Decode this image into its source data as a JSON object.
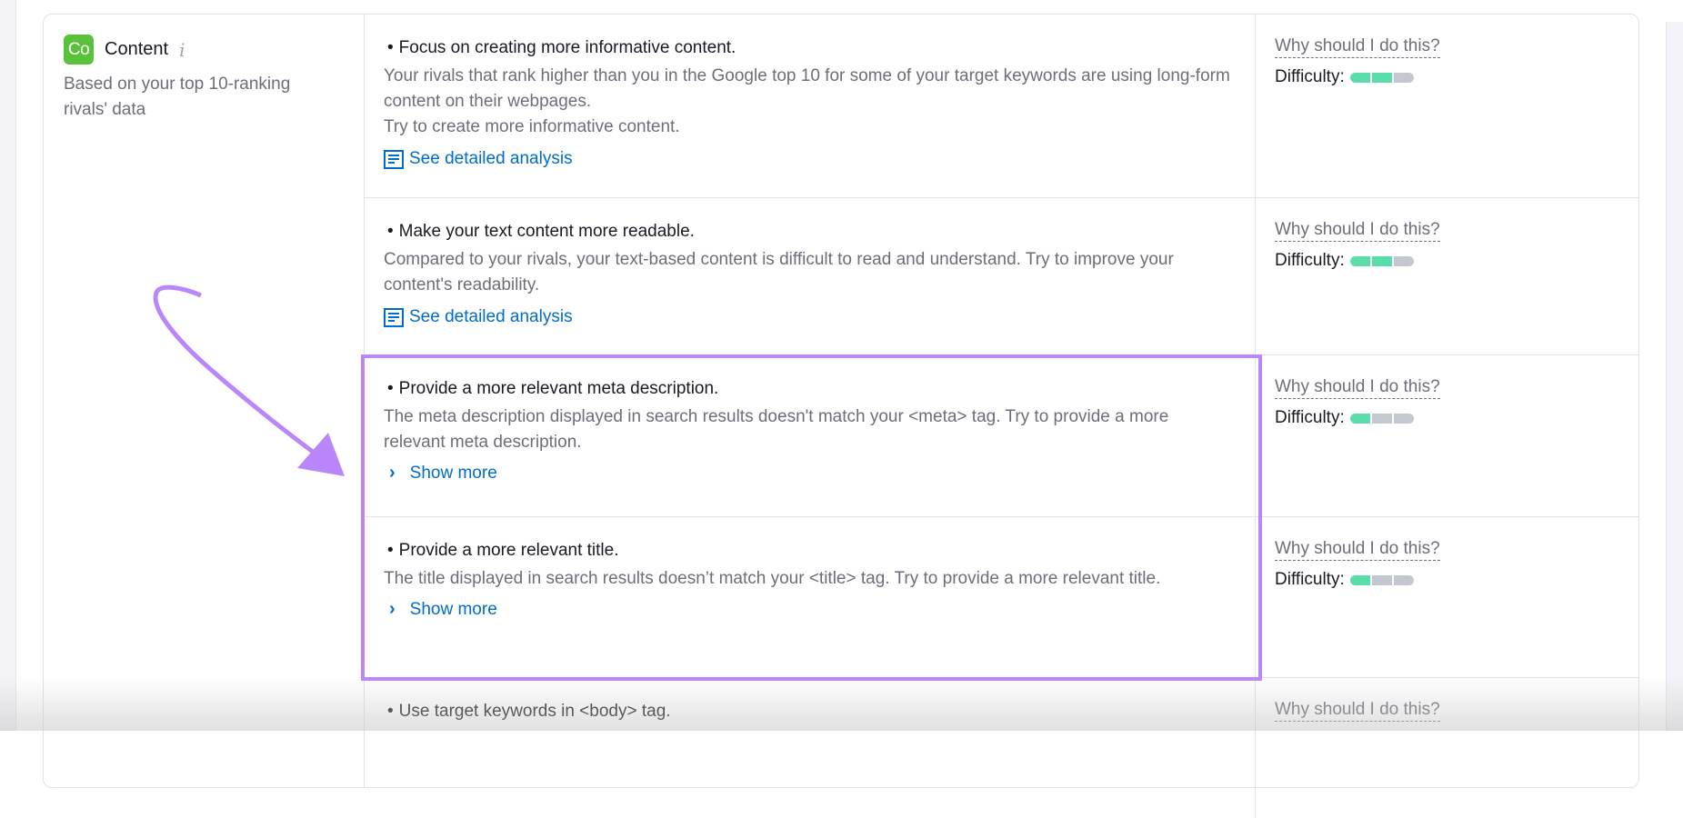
{
  "category": {
    "badge": "Co",
    "badge_color": "#5ac13a",
    "title": "Content",
    "info_icon": "i",
    "subtitle": "Based on your top 10-ranking rivals' data"
  },
  "recommendations": [
    {
      "title": "Focus on creating more informative content.",
      "description": "Your rivals that rank higher than you in the Google top 10 for some of your target keywords are using long-form content on their webpages.\nTry to create more informative content.",
      "link_label": "See detailed analysis",
      "link_icon": "document-icon",
      "why_label": "Why should I do this?",
      "difficulty_label": "Difficulty:",
      "difficulty": {
        "level": 2,
        "max": 3
      }
    },
    {
      "title": "Make your text content more readable.",
      "description": "Compared to your rivals, your text-based content is difficult to read and understand. Try to improve your content's readability.",
      "link_label": "See detailed analysis",
      "link_icon": "document-icon",
      "why_label": "Why should I do this?",
      "difficulty_label": "Difficulty:",
      "difficulty": {
        "level": 2,
        "max": 3
      }
    },
    {
      "title": "Provide a more relevant meta description.",
      "description": "The meta description displayed in search results doesn't match your <meta> tag. Try to provide a more relevant meta description.",
      "link_label": "Show more",
      "link_icon": "chevron-right-icon",
      "why_label": "Why should I do this?",
      "difficulty_label": "Difficulty:",
      "difficulty": {
        "level": 1,
        "max": 3
      }
    },
    {
      "title": "Provide a more relevant title.",
      "description": "The title displayed in search results doesn’t match your <title> tag. Try to provide a more relevant title.",
      "link_label": "Show more",
      "link_icon": "chevron-right-icon",
      "why_label": "Why should I do this?",
      "difficulty_label": "Difficulty:",
      "difficulty": {
        "level": 1,
        "max": 3
      }
    },
    {
      "title": "Use target keywords in <body> tag.",
      "description": "",
      "link_label": "",
      "link_icon": "",
      "why_label": "Why should I do this?",
      "difficulty_label": "",
      "difficulty": null
    }
  ],
  "annotation": {
    "color": "#b987fb",
    "highlighted_items": [
      2,
      3
    ]
  },
  "colors": {
    "link": "#006dca",
    "difficulty_on": "#59ddaa",
    "difficulty_off": "#c4c7cf"
  }
}
